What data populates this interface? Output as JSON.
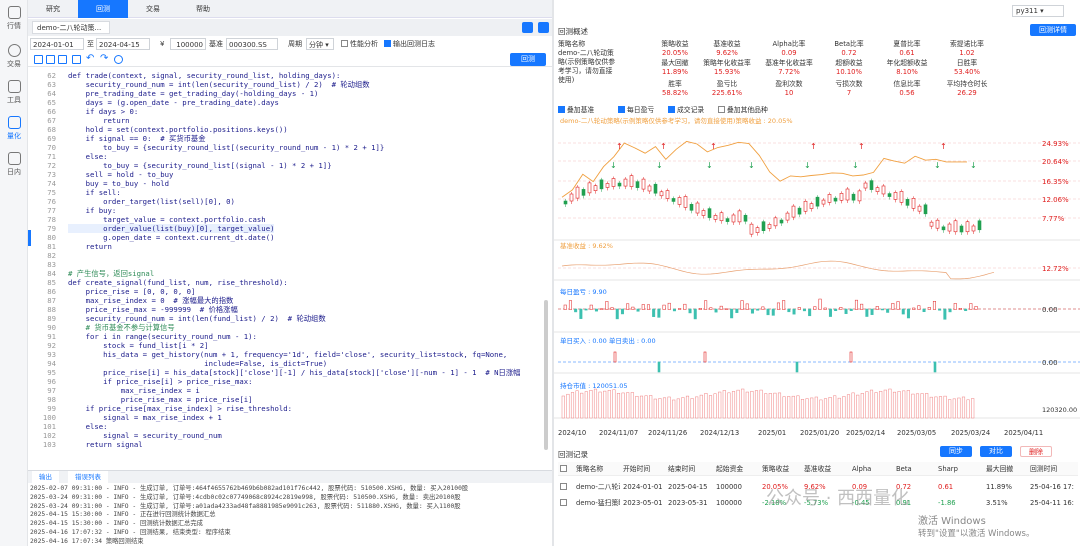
{
  "rail": [
    {
      "label": "行情",
      "icon": "monitor-icon"
    },
    {
      "label": "交易",
      "icon": "exchange-icon"
    },
    {
      "label": "工具",
      "icon": "toolbox-icon"
    },
    {
      "label": "量化",
      "icon": "chart-line-icon"
    },
    {
      "label": "日内",
      "icon": "clock-icon"
    }
  ],
  "top_tabs": [
    "研究",
    "回测",
    "交易",
    "帮助"
  ],
  "active_tab": "回测",
  "file_tab": "demo-二八轮动策...",
  "params": {
    "start": "2024-01-01",
    "to": "至",
    "end": "2024-04-15",
    "currency": "¥",
    "capital": "100000",
    "benchmark_label": "基准",
    "benchmark": "000300.SS",
    "freq_label": "周期",
    "freq": "分钟",
    "perf_label": "性能分析",
    "log_label": "输出回测日志"
  },
  "run_label": "回测",
  "code_start_line": 62,
  "code_lines": [
    {
      "t": "def trade(context, signal, security_round_list, holding_days):",
      "c": 0
    },
    {
      "t": "    security_round_num = int(len(security_round_list) / 2)  # 轮动组数",
      "c": 0
    },
    {
      "t": "    pre_trading_date = get_trading_day(-holding_days - 1)",
      "c": 0
    },
    {
      "t": "    days = (g.open_date - pre_trading_date).days",
      "c": 0
    },
    {
      "t": "    if days > 0:",
      "c": 0
    },
    {
      "t": "        return",
      "c": 0
    },
    {
      "t": "    hold = set(context.portfolio.positions.keys())",
      "c": 0
    },
    {
      "t": "    if signal == 0:  # 买货币基金",
      "c": 0
    },
    {
      "t": "        to_buy = {security_round_list[(security_round_num - 1) * 2 + 1]}",
      "c": 0
    },
    {
      "t": "    else:",
      "c": 0
    },
    {
      "t": "        to_buy = {security_round_list[(signal - 1) * 2 + 1]}",
      "c": 0
    },
    {
      "t": "    sell = hold - to_buy",
      "c": 0
    },
    {
      "t": "    buy = to_buy - hold",
      "c": 0
    },
    {
      "t": "    if sell:",
      "c": 0
    },
    {
      "t": "        order_target(list(sell)[0], 0)",
      "c": 0
    },
    {
      "t": "    if buy:",
      "c": 0
    },
    {
      "t": "        target_value = context.portfolio.cash",
      "c": 0
    },
    {
      "t": "        order_value(list(buy)[0], target_value)",
      "c": 2
    },
    {
      "t": "        g.open_date = context.current_dt.date()",
      "c": 0
    },
    {
      "t": "    return",
      "c": 0
    },
    {
      "t": "",
      "c": 0
    },
    {
      "t": "",
      "c": 0
    },
    {
      "t": "# 产生信号，返回signal",
      "c": 1
    },
    {
      "t": "def create_signal(fund_list, num, rise_threshold):",
      "c": 0
    },
    {
      "t": "    price_rise = [0, 0, 0, 0]",
      "c": 0
    },
    {
      "t": "    max_rise_index = 0  # 涨幅最大的指数",
      "c": 0
    },
    {
      "t": "    price_rise_max = -999999  # 价格涨幅",
      "c": 0
    },
    {
      "t": "    security_round_num = int(len(fund_list) / 2)  # 轮动组数",
      "c": 0
    },
    {
      "t": "    # 货币基金不参与计算信号",
      "c": 1
    },
    {
      "t": "    for i in range(security_round_num - 1):",
      "c": 0
    },
    {
      "t": "        stock = fund_list[i * 2]",
      "c": 0
    },
    {
      "t": "        his_data = get_history(num + 1, frequency='1d', field='close', security_list=stock, fq=None,",
      "c": 0
    },
    {
      "t": "                               include=False, is_dict=True)",
      "c": 0
    },
    {
      "t": "        price_rise[i] = his_data[stock]['close'][-1] / his_data[stock]['close'][-num - 1] - 1  # N日涨幅",
      "c": 0
    },
    {
      "t": "        if price_rise[i] > price_rise_max:",
      "c": 0
    },
    {
      "t": "            max_rise_index = i",
      "c": 0
    },
    {
      "t": "            price_rise_max = price_rise[i]",
      "c": 0
    },
    {
      "t": "    if price_rise[max_rise_index] > rise_threshold:",
      "c": 0
    },
    {
      "t": "        signal = max_rise_index + 1",
      "c": 0
    },
    {
      "t": "    else:",
      "c": 0
    },
    {
      "t": "        signal = security_round_num",
      "c": 0
    },
    {
      "t": "    return signal",
      "c": 0
    }
  ],
  "log_tabs": [
    "输出",
    "错误列表"
  ],
  "log_lines": [
    "2025-02-07 09:31:00 - INFO - 生成订单, 订单号:464f4655762b469b6b082ad101f76c442, 股票代码: 510500.XSHG, 数量: 买入20100股",
    "2025-03-24 09:31:00 - INFO - 生成订单, 订单号:4cdb0c02c07749068c8924c2819e998, 股票代码: 510500.XSHG, 数量: 卖出20100股",
    "2025-03-24 09:31:00 - INFO - 生成订单, 订单号:a01ada4233ad48fa8881985e9091c263, 股票代码: 511880.XSHG, 数量: 买入1100股",
    "2025-04-15 15:30:00 - INFO - 正在进行回测统计数据汇总",
    "2025-04-15 15:30:00 - INFO - 回测统计数据汇总完成",
    "2025-04-16 17:07:32 - INFO - 回测结果, 结束类型: 程序结束",
    "2025-04-16 17:07:34 策略回测结束"
  ],
  "env": "py311",
  "summary_title": "回测概述",
  "detail_label": "回测详情",
  "strategy": {
    "label": "策略名称",
    "name": "demo-二八轮动策略(示例策略仅供参考学习，请勿直接使用)"
  },
  "metrics": [
    {
      "l": "策略收益",
      "v": "20.05%",
      "red": true
    },
    {
      "l": "基准收益",
      "v": "9.62%",
      "red": true
    },
    {
      "l": "Alpha比率",
      "v": "0.09",
      "red": true
    },
    {
      "l": "Beta比率",
      "v": "0.72",
      "red": true
    },
    {
      "l": "夏普比率",
      "v": "0.61",
      "red": true
    },
    {
      "l": "索提诺比率",
      "v": "1.02",
      "red": true
    },
    {
      "l": "最大回撤",
      "v": "11.89%",
      "red": true
    },
    {
      "l": "策略年化收益率",
      "v": "15.93%",
      "red": true
    },
    {
      "l": "基准年化收益率",
      "v": "7.72%",
      "red": true
    },
    {
      "l": "超额收益",
      "v": "10.10%",
      "red": true
    },
    {
      "l": "年化超额收益",
      "v": "8.10%",
      "red": true
    },
    {
      "l": "日胜率",
      "v": "53.40%",
      "red": true
    },
    {
      "l": "胜率",
      "v": "58.82%",
      "red": true
    },
    {
      "l": "盈亏比",
      "v": "225.61%",
      "red": true
    },
    {
      "l": "盈利次数",
      "v": "10",
      "red": true
    },
    {
      "l": "亏损次数",
      "v": "7",
      "red": true
    },
    {
      "l": "信息比率",
      "v": "0.56",
      "red": true
    },
    {
      "l": "平均持仓时长",
      "v": "26.29",
      "red": true
    }
  ],
  "legend": [
    "叠加基准",
    "每日盈亏",
    "成交记录",
    "叠加其他品种"
  ],
  "chart_data": {
    "type": "line",
    "title": "",
    "main_caption": "demo-二八轮动策略(示例策略仅供参考学习，请勿直接使用)策略收益 : 20.05%",
    "y_ticks": [
      "24.93%",
      "20.64%",
      "16.35%",
      "12.06%",
      "7.77%"
    ],
    "bench_caption": "基准收益 : 9.62%",
    "bench_tick": "12.72%",
    "pnl_caption": "每日盈亏 : 9.90",
    "pnl_tick": "0.00",
    "trade_caption": "单日买入 : 0.00  单日卖出 : 0.00",
    "trade_tick": "0.00",
    "hold_caption": "持仓市值 : 120051.05",
    "hold_tick": "120320.00",
    "x_labels": [
      "2024/10",
      "2024/11/07",
      "2024/11/26",
      "2024/12/13",
      "2025/01",
      "2025/01/20",
      "2025/02/14",
      "2025/03/05",
      "2025/03/24",
      "2025/04/11"
    ],
    "strategy_return": [
      12.5,
      14.2,
      17.8,
      16.1,
      19.5,
      21.8,
      24.9,
      23.8,
      22.6,
      24.1,
      21.2,
      23.5,
      25.3,
      24.7,
      22.9,
      23.9,
      24.4,
      25.1,
      24.8,
      22.1,
      18.3,
      16.2,
      17.4,
      17.2,
      17.5,
      17.7,
      18.1,
      18.0,
      17.4,
      17.6,
      18.2,
      21.4,
      20.8,
      20.3,
      21.9,
      21.0,
      21.2,
      20.6,
      20.6,
      20.6
    ]
  },
  "records": {
    "title": "回测记录",
    "buttons": [
      "同步",
      "对比",
      "删除"
    ],
    "columns": [
      "策略名称",
      "开始时间",
      "结束时间",
      "起始资金",
      "策略收益",
      "基准收益",
      "Alpha",
      "Beta",
      "Sharp",
      "最大回撤",
      "回测时间"
    ],
    "rows": [
      [
        "demo-二八轮动",
        "2024-01-01",
        "2025-04-15",
        "100000",
        "20.05%",
        "9.62%",
        "0.09",
        "0.72",
        "0.61",
        "11.89%",
        "25-04-16 17:"
      ],
      [
        "demo-猛扫策略",
        "2023-05-01",
        "2023-05-31",
        "100000",
        "-2.18%",
        "-5.73%",
        "-0.45",
        "0.91",
        "-1.86",
        "3.51%",
        "25-04-11 16:"
      ]
    ]
  },
  "watermark": "公众号 · 西西量化",
  "activate": {
    "l1": "激活 Windows",
    "l2": "转到\"设置\"以激活 Windows。"
  }
}
